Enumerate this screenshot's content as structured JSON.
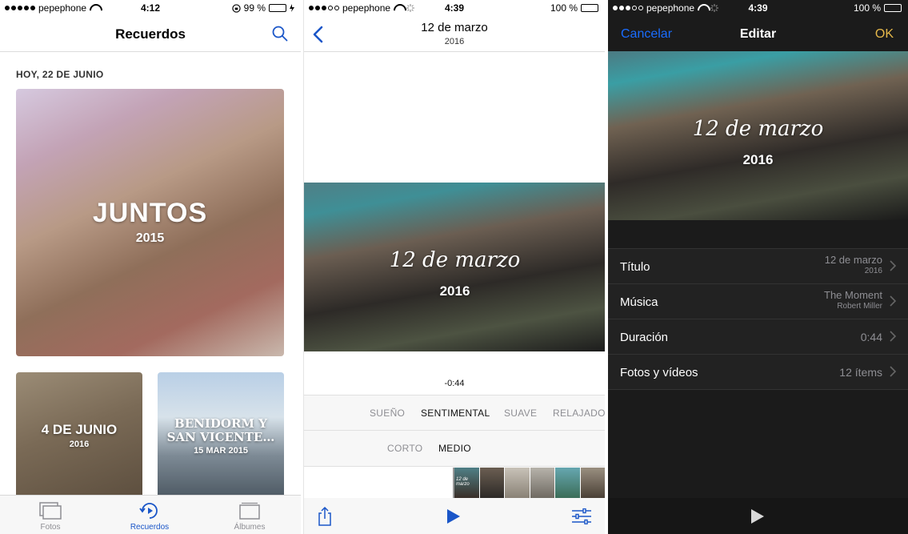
{
  "colors": {
    "ios_blue": "#1a56c8",
    "ok_yellow": "#e6b84a",
    "battery_green": "#4cd964"
  },
  "panel1": {
    "status": {
      "carrier": "pepephone",
      "time": "4:12",
      "battery": "99 %",
      "battery_level": 0.99
    },
    "nav": {
      "title": "Recuerdos"
    },
    "section_header": "HOY, 22 DE JUNIO",
    "featured": {
      "title": "JUNTOS",
      "year": "2015"
    },
    "memories": [
      {
        "title": "4 DE JUNIO",
        "subtitle": "2016"
      },
      {
        "title": "BENIDORM Y SAN VICENTE…",
        "subtitle": "15 MAR 2015"
      }
    ],
    "tabs": [
      {
        "label": "Fotos",
        "icon": "photos-icon"
      },
      {
        "label": "Recuerdos",
        "icon": "memories-icon"
      },
      {
        "label": "Álbumes",
        "icon": "albums-icon"
      }
    ]
  },
  "panel2": {
    "status": {
      "carrier": "pepephone",
      "time": "4:39",
      "battery": "100 %",
      "battery_level": 1.0
    },
    "nav": {
      "title": "12 de marzo",
      "subtitle": "2016"
    },
    "video": {
      "title": "12 de marzo",
      "year": "2016"
    },
    "duration": "-0:44",
    "moods": [
      "SUEÑO",
      "SENTIMENTAL",
      "SUAVE",
      "RELAJADO"
    ],
    "selected_mood": "SENTIMENTAL",
    "lengths": [
      "CORTO",
      "MEDIO"
    ],
    "selected_length": "MEDIO",
    "filmstrip_title": "12 de marzo"
  },
  "panel3": {
    "status": {
      "carrier": "pepephone",
      "time": "4:39",
      "battery": "100 %",
      "battery_level": 1.0
    },
    "nav": {
      "cancel": "Cancelar",
      "title": "Editar",
      "ok": "OK"
    },
    "video": {
      "title": "12 de marzo",
      "year": "2016"
    },
    "rows": [
      {
        "label": "Título",
        "value": "12 de marzo",
        "subvalue": "2016"
      },
      {
        "label": "Música",
        "value": "The Moment",
        "subvalue": "Robert Miller"
      },
      {
        "label": "Duración",
        "value": "0:44"
      },
      {
        "label": "Fotos y vídeos",
        "value": "12 ítems"
      }
    ]
  }
}
